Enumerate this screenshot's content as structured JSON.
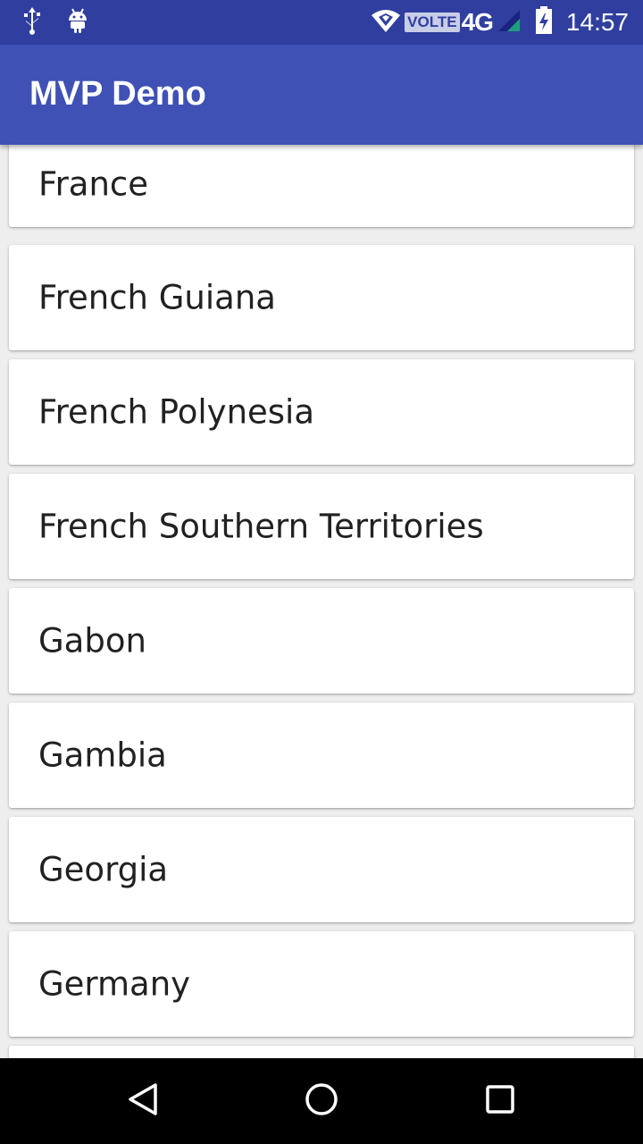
{
  "status_bar": {
    "left_icons": [
      "usb-icon",
      "android-icon"
    ],
    "right_icons": [
      "wifi-icon",
      "signal-icon",
      "battery-icon"
    ],
    "volte_label": "VOLTE",
    "network_label": "4G",
    "time": "14:57"
  },
  "app_bar": {
    "title": "MVP Demo",
    "color": "#3f51b5",
    "status_color": "#303f9f"
  },
  "countries": [
    {
      "name": "France"
    },
    {
      "name": "French Guiana"
    },
    {
      "name": "French Polynesia"
    },
    {
      "name": "French Southern Territories"
    },
    {
      "name": "Gabon"
    },
    {
      "name": "Gambia"
    },
    {
      "name": "Georgia"
    },
    {
      "name": "Germany"
    }
  ],
  "nav_bar": {
    "icons": [
      "back-icon",
      "home-icon",
      "recents-icon"
    ]
  }
}
